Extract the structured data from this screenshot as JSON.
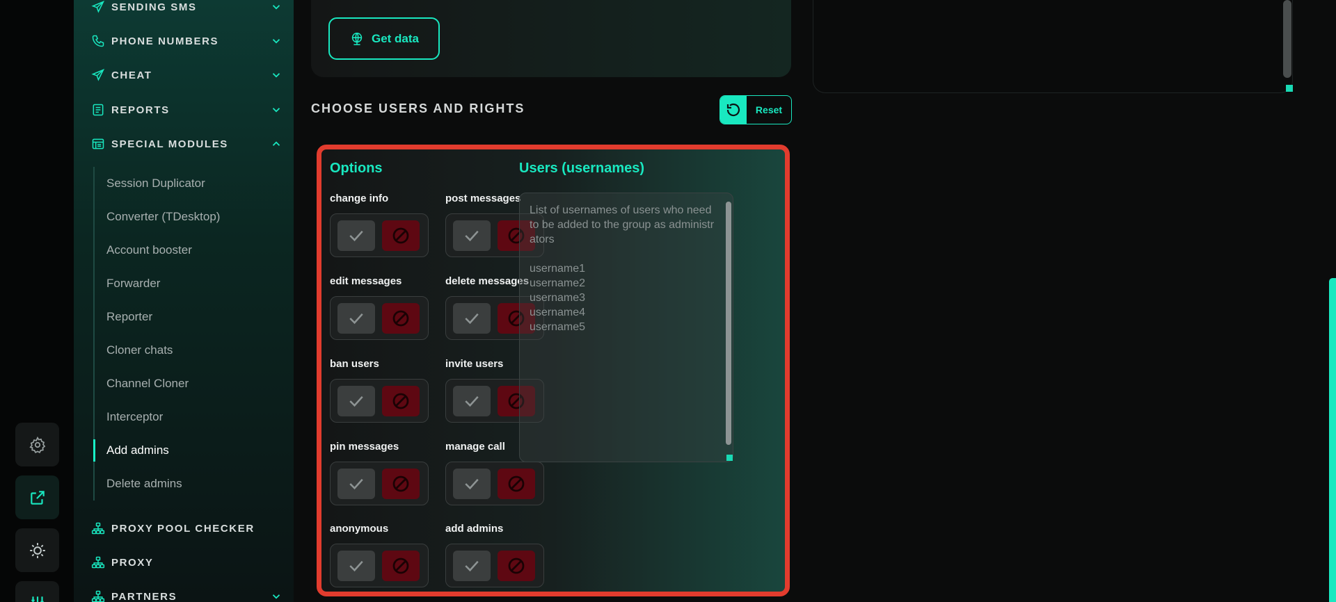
{
  "sidebar": {
    "top_items": [
      {
        "label": "SENDING SMS",
        "icon": "send-icon"
      },
      {
        "label": "PHONE NUMBERS",
        "icon": "phone-icon"
      },
      {
        "label": "CHEAT",
        "icon": "send-icon"
      },
      {
        "label": "REPORTS",
        "icon": "report-icon"
      },
      {
        "label": "SPECIAL MODULES",
        "icon": "modules-icon"
      }
    ],
    "submenu": [
      "Session Duplicator",
      "Converter (TDesktop)",
      "Account booster",
      "Forwarder",
      "Reporter",
      "Cloner chats",
      "Channel Cloner",
      "Interceptor",
      "Add admins",
      "Delete admins"
    ],
    "active_submenu": "Add admins",
    "bottom_items": [
      {
        "label": "PROXY POOL CHECKER",
        "icon": "network-icon"
      },
      {
        "label": "PROXY",
        "icon": "network-icon"
      },
      {
        "label": "PARTNERS",
        "icon": "network-icon"
      }
    ]
  },
  "rail": {
    "buttons": [
      "gear-icon",
      "external-link-icon",
      "sun-icon",
      "sliders-icon"
    ]
  },
  "main": {
    "get_data_label": "Get data",
    "section_title": "CHOOSE USERS AND RIGHTS",
    "reset_label": "Reset",
    "options_title": "Options",
    "users_title": "Users (usernames)",
    "options": [
      "change info",
      "post messages",
      "edit messages",
      "delete messages",
      "ban users",
      "invite users",
      "pin messages",
      "manage call",
      "anonymous",
      "add admins"
    ],
    "usernames_placeholder": "List of usernames of users who need to be added to the group as administrators\n\nusername1\nusername2\nusername3\nusername4\nusername5"
  },
  "colors": {
    "accent": "#19e8c0",
    "highlight": "#e23c2e",
    "deny": "#5e0812"
  }
}
